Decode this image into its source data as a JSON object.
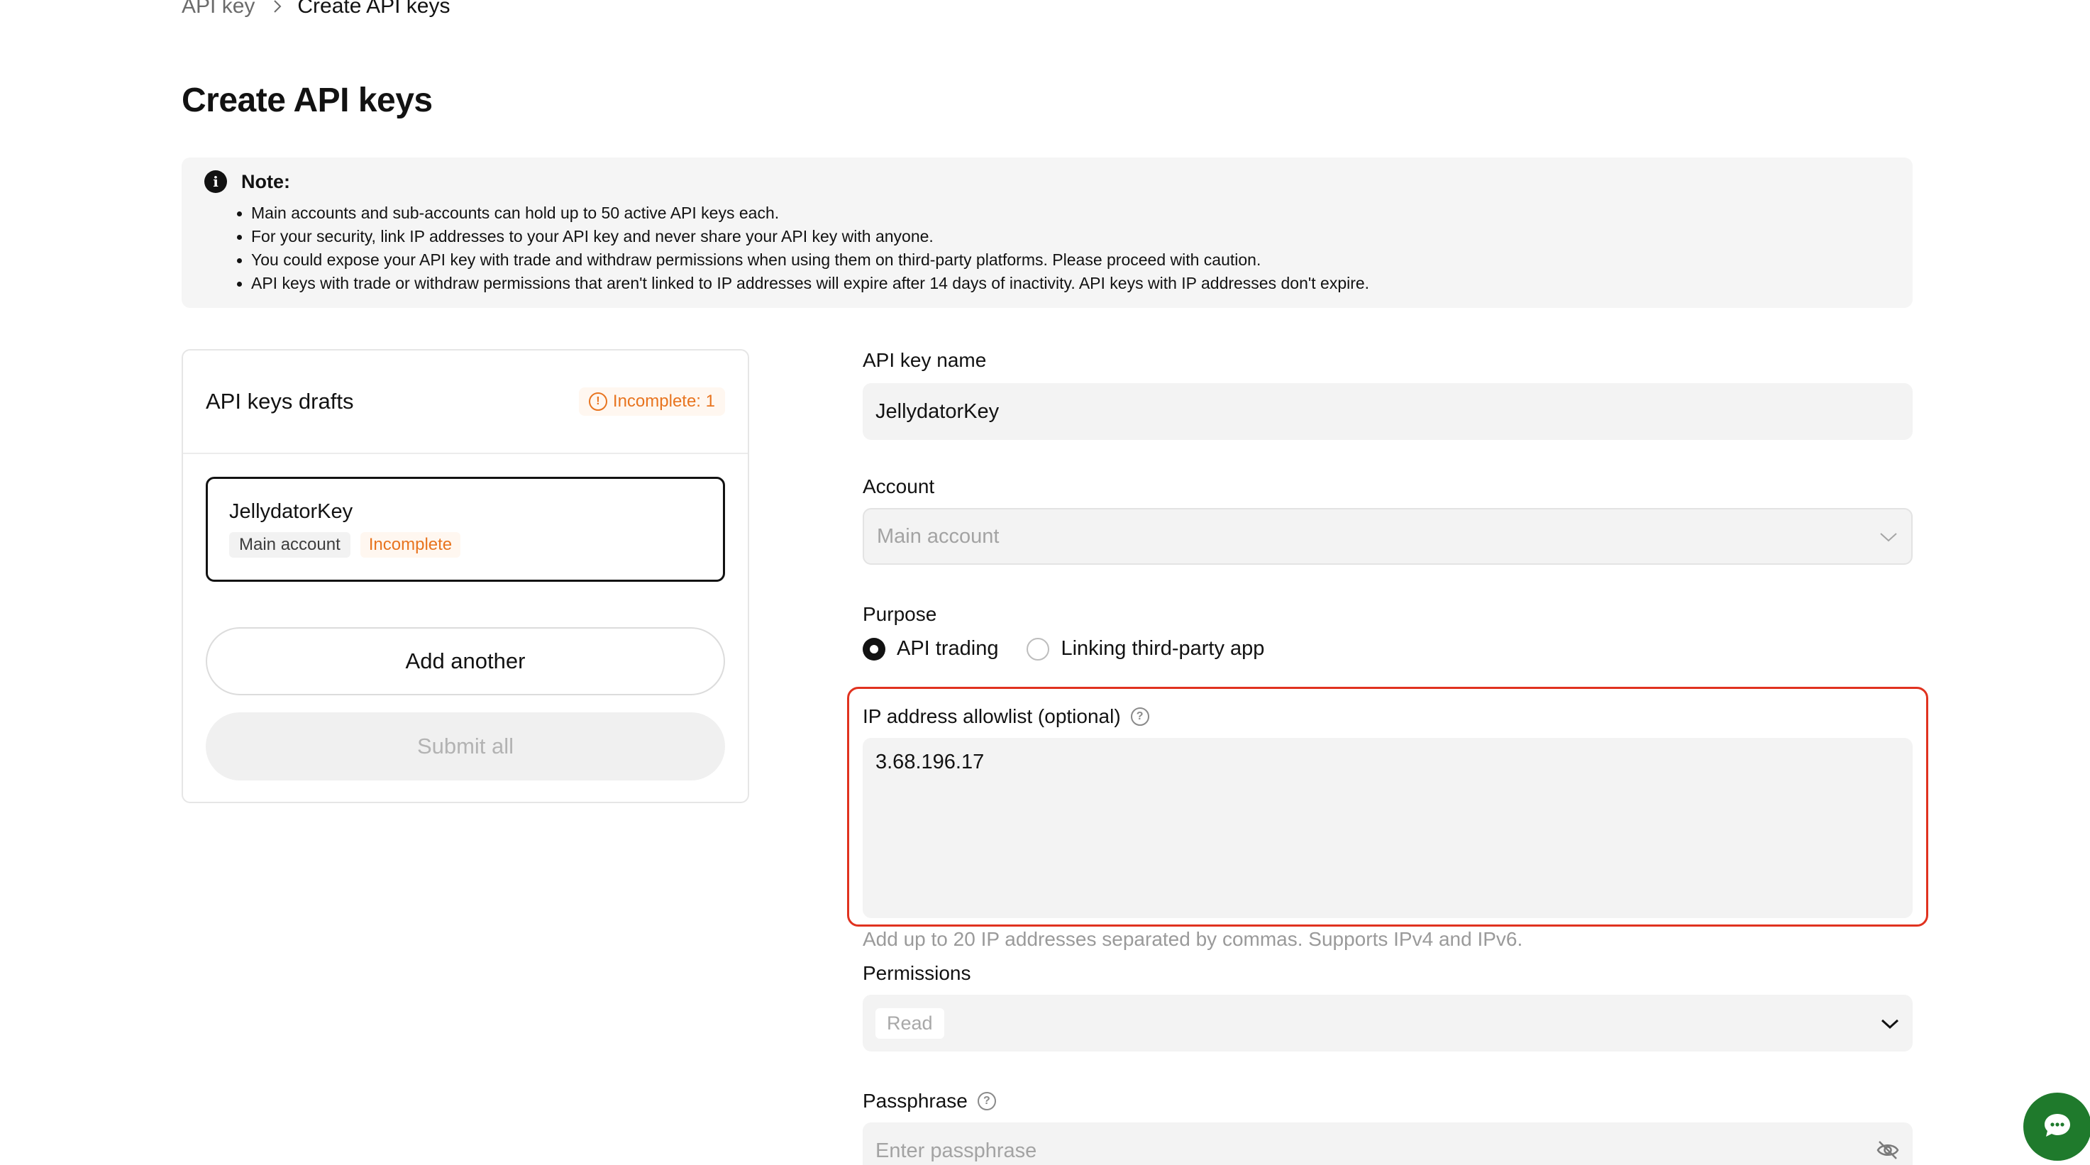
{
  "breadcrumb": {
    "parent": "API key",
    "current": "Create API keys"
  },
  "page_title": "Create API keys",
  "note": {
    "title": "Note:",
    "items": [
      "Main accounts and sub-accounts can hold up to 50 active API keys each.",
      "For your security, link IP addresses to your API key and never share your API key with anyone.",
      "You could expose your API key with trade and withdraw permissions when using them on third-party platforms. Please proceed with caution.",
      "API keys with trade or withdraw permissions that aren't linked to IP addresses will expire after 14 days of inactivity. API keys with IP addresses don't expire."
    ]
  },
  "drafts": {
    "title": "API keys drafts",
    "incomplete_badge": "Incomplete: 1",
    "card": {
      "name": "JellydatorKey",
      "account": "Main account",
      "status": "Incomplete"
    },
    "add_label": "Add another",
    "submit_label": "Submit all"
  },
  "form": {
    "name_label": "API key name",
    "name_value": "JellydatorKey",
    "account_label": "Account",
    "account_value": "Main account",
    "purpose_label": "Purpose",
    "purpose_options": [
      {
        "label": "API trading",
        "selected": true
      },
      {
        "label": "Linking third-party app",
        "selected": false
      }
    ],
    "ip_label": "IP address allowlist (optional)",
    "ip_value": "3.68.196.17",
    "ip_hint": "Add up to 20 IP addresses separated by commas. Supports IPv4 and IPv6.",
    "permissions_label": "Permissions",
    "permissions_value": "Read",
    "passphrase_label": "Passphrase",
    "passphrase_placeholder": "Enter passphrase"
  },
  "colors": {
    "highlight": "#e0321f",
    "warning": "#e8741f",
    "chat": "#1f7a2c"
  }
}
